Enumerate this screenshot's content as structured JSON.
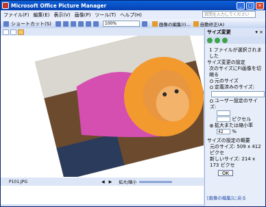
{
  "titlebar": {
    "title": "Microsoft Office Picture Manager",
    "min": "_",
    "max": "□",
    "close": "×"
  },
  "menu": {
    "items": [
      "ファイル(F)",
      "編集(E)",
      "表示(V)",
      "画像(P)",
      "ツール(T)",
      "ヘルプ(H)"
    ],
    "help_placeholder": "質問を入力してください"
  },
  "toolbar": {
    "shortcut": "ショートカット(S)",
    "zoom": "100%",
    "edit_pictures": "画像の編集(I)...",
    "auto_correct": "自動修正(A)"
  },
  "status": {
    "filename": "P101.JPG",
    "zoom_label": "拡大/縮小"
  },
  "taskpane": {
    "title": "サイズ変更",
    "files_selected": "1 ファイルが選択されました",
    "section_resize": "サイズ変更の設定",
    "resize_to": "次のサイズにFI画像を切縮る",
    "opt_original": "元のサイズ",
    "opt_predefined": "定義済みのサイズ:",
    "opt_custom": "ユーザー設定のサイズ:",
    "pixels": "ピクセル",
    "opt_percent": "拡大または縮小率",
    "percent": "42",
    "percent_unit": "%",
    "summary": "サイズの設定の概要",
    "original_label": "元のサイズ:",
    "original_value": "509 x 412 ピクセ",
    "new_label": "新しいサイズ:",
    "new_value": "214 x 173 ピクセ",
    "ok": "OK",
    "back_link": "[画像の編集]に戻る"
  }
}
